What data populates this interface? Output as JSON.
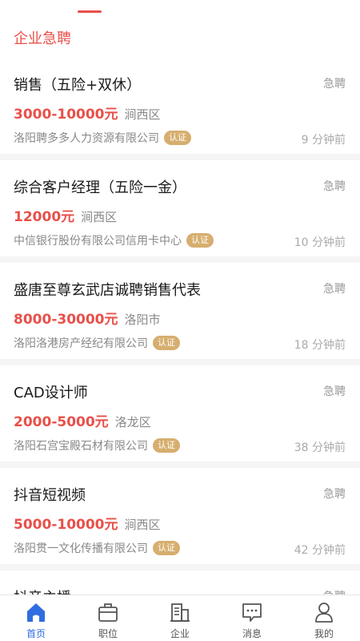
{
  "header": {
    "section_title": "企业急聘"
  },
  "jobs": [
    {
      "title": "销售（五险+双休）",
      "urgent": "急聘",
      "salary": "3000-10000元",
      "district": "涧西区",
      "company": "洛阳聘多多人力资源有限公司",
      "badge": "认证",
      "time": "9 分钟前"
    },
    {
      "title": "综合客户经理（五险一金）",
      "urgent": "急聘",
      "salary": "12000元",
      "district": "涧西区",
      "company": "中信银行股份有限公司信用卡中心",
      "badge": "认证",
      "time": "10 分钟前"
    },
    {
      "title": "盛唐至尊玄武店诚聘销售代表",
      "urgent": "急聘",
      "salary": "8000-30000元",
      "district": "洛阳市",
      "company": "洛阳洛港房产经纪有限公司",
      "badge": "认证",
      "time": "18 分钟前"
    },
    {
      "title": "CAD设计师",
      "urgent": "急聘",
      "salary": "2000-5000元",
      "district": "洛龙区",
      "company": "洛阳石宫宝殿石材有限公司",
      "badge": "认证",
      "time": "38 分钟前"
    },
    {
      "title": "抖音短视频",
      "urgent": "急聘",
      "salary": "5000-10000元",
      "district": "涧西区",
      "company": "洛阳贯一文化传播有限公司",
      "badge": "认证",
      "time": "42 分钟前"
    },
    {
      "title": "抖音主播",
      "urgent": "急聘",
      "salary": "",
      "district": "",
      "company": "",
      "badge": "",
      "time": ""
    }
  ],
  "tabbar": {
    "items": [
      {
        "label": "首页",
        "icon": "home-icon",
        "active": true
      },
      {
        "label": "职位",
        "icon": "briefcase-icon",
        "active": false
      },
      {
        "label": "企业",
        "icon": "building-icon",
        "active": false
      },
      {
        "label": "消息",
        "icon": "message-icon",
        "active": false
      },
      {
        "label": "我的",
        "icon": "profile-icon",
        "active": false
      }
    ]
  },
  "colors": {
    "accent": "#e8504a",
    "active_tab": "#2f6de0",
    "badge": "#d6ae6e"
  }
}
